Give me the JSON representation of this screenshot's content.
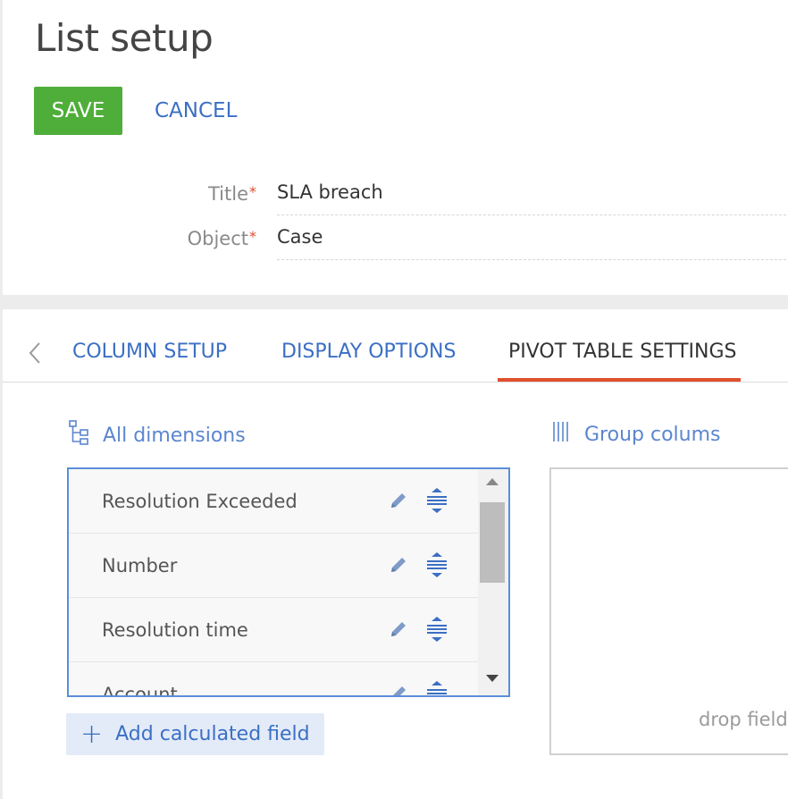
{
  "header": {
    "title": "List setup",
    "save_label": "SAVE",
    "cancel_label": "CANCEL"
  },
  "form": {
    "title_label": "Title",
    "title_value": "SLA breach",
    "object_label": "Object",
    "object_value": "Case",
    "required_mark": "*"
  },
  "tabs": [
    {
      "label": "COLUMN SETUP",
      "active": false
    },
    {
      "label": "DISPLAY OPTIONS",
      "active": false
    },
    {
      "label": "PIVOT TABLE SETTINGS",
      "active": true
    }
  ],
  "dimensions": {
    "header": "All dimensions",
    "items": [
      {
        "label": "Resolution Exceeded"
      },
      {
        "label": "Number"
      },
      {
        "label": "Resolution time"
      },
      {
        "label": "Account"
      }
    ],
    "add_label": "Add calculated field",
    "add_icon": "+"
  },
  "group_columns": {
    "header": "Group colums",
    "drop_hint": "drop field"
  },
  "icons": {
    "back": "chevron-left-icon",
    "dimensions": "hierarchy-icon",
    "group": "columns-icon",
    "edit": "pencil-icon",
    "drag": "drag-handle-icon"
  },
  "colors": {
    "accent": "#3b6fc4",
    "save": "#4fae3a",
    "tab_underline": "#e0502c",
    "required": "#e04b2c"
  }
}
